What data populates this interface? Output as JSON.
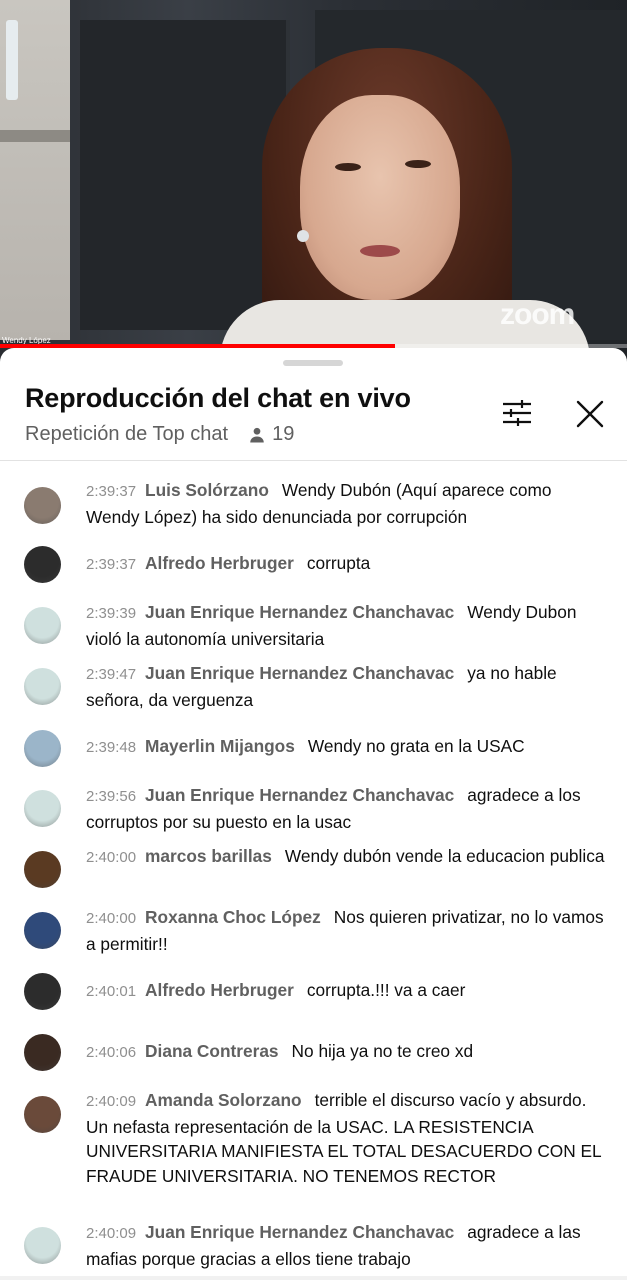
{
  "video": {
    "speaker_name": "Wendy López",
    "watermark": "zoom",
    "progress_fraction": 0.63
  },
  "chat_panel": {
    "title": "Reproducción del chat en vivo",
    "subtitle": "Repetición de Top chat",
    "viewer_count": "19",
    "filter_icon": "tune-sliders-icon",
    "close_icon": "close-x-icon"
  },
  "messages": [
    {
      "time": "2:39:37",
      "author": "Luis Solórzano",
      "text": "Wendy Dubón (Aquí aparece como Wendy López) ha sido denunciada por corrupción",
      "avatar_color": "#8a7b70"
    },
    {
      "time": "2:39:37",
      "author": "Alfredo Herbruger",
      "text": "corrupta",
      "avatar_color": "#2c2c2c"
    },
    {
      "time": "2:39:39",
      "author": "Juan Enrique Hernandez Chanchavac",
      "text": "Wendy Dubon violó la autonomía universitaria",
      "avatar_color": "#cfe0de"
    },
    {
      "time": "2:39:47",
      "author": "Juan Enrique Hernandez Chanchavac",
      "text": "ya no hable señora, da verguenza",
      "avatar_color": "#cfe0de"
    },
    {
      "time": "2:39:48",
      "author": "Mayerlin Mijangos",
      "text": "Wendy no grata en la USAC",
      "avatar_color": "#9bb5c9"
    },
    {
      "time": "2:39:56",
      "author": "Juan Enrique Hernandez Chanchavac",
      "text": "agradece a los corruptos por su puesto en la usac",
      "avatar_color": "#cfe0de"
    },
    {
      "time": "2:40:00",
      "author": "marcos barillas",
      "text": "Wendy dubón vende la educacion publica",
      "avatar_color": "#5a3a22"
    },
    {
      "time": "2:40:00",
      "author": "Roxanna Choc López",
      "text": "Nos quieren privatizar, no lo vamos a permitir!!",
      "avatar_color": "#2f4a7a"
    },
    {
      "time": "2:40:01",
      "author": "Alfredo Herbruger",
      "text": "corrupta.!!! va a caer",
      "avatar_color": "#2c2c2c"
    },
    {
      "time": "2:40:06",
      "author": "Diana Contreras",
      "text": "No hija ya no te creo xd",
      "avatar_color": "#3a2a22"
    },
    {
      "time": "2:40:09",
      "author": "Amanda Solorzano",
      "text": "terrible el discurso vacío y absurdo. Un nefasta representación de la USAC. LA RESISTENCIA UNIVERSITARIA MANIFIESTA EL TOTAL DESACUERDO CON EL FRAUDE UNIVERSITARIA. NO TENEMOS RECTOR",
      "avatar_color": "#6a4a3a"
    },
    {
      "time": "2:40:09",
      "author": "Juan Enrique Hernandez Chanchavac",
      "text": "agradece a las mafias porque gracias a ellos tiene trabajo",
      "avatar_color": "#cfe0de"
    }
  ]
}
